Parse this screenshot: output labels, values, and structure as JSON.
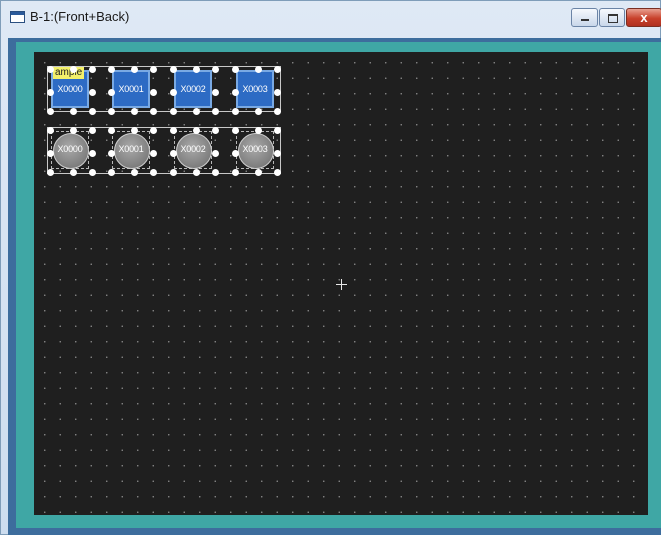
{
  "window": {
    "title": "B-1:(Front+Back)",
    "buttons": {
      "minimize": "minimize",
      "maximize": "maximize",
      "close": "x"
    }
  },
  "canvas": {
    "sample_tag": "ample",
    "objects": [
      {
        "shape": "square",
        "label": "X0000"
      },
      {
        "shape": "square",
        "label": "X0001"
      },
      {
        "shape": "square",
        "label": "X0002"
      },
      {
        "shape": "square",
        "label": "X0003"
      },
      {
        "shape": "circle",
        "label": "X0000"
      },
      {
        "shape": "circle",
        "label": "X0001"
      },
      {
        "shape": "circle",
        "label": "X0002"
      },
      {
        "shape": "circle",
        "label": "X0003"
      }
    ]
  },
  "colors": {
    "canvas_bg": "#1f1f1f",
    "square_fill": "#2d6bc4",
    "circle_fill": "#808080",
    "side_teal": "#3fa7a5",
    "side_blue": "#3d6d9d"
  }
}
